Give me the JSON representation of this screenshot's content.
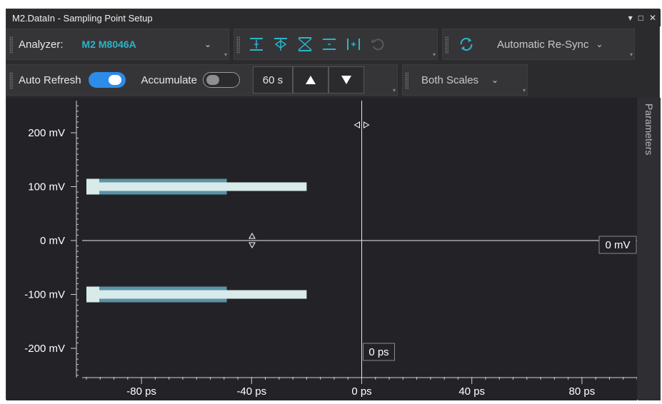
{
  "window": {
    "title": "M2.DataIn - Sampling Point Setup",
    "controls": [
      "▾",
      "□",
      "✕"
    ]
  },
  "toolbar1": {
    "analyzer_label": "Analyzer:",
    "analyzer_value": "M2 M8046A",
    "resync_label": "Automatic Re-Sync",
    "icons": [
      "center-vertical-icon",
      "center-eye-icon",
      "fit-eye-icon",
      "center-horizontal-icon",
      "cursor-offset-icon",
      "undo-icon",
      "resync-icon"
    ]
  },
  "toolbar2": {
    "auto_refresh_label": "Auto Refresh",
    "auto_refresh_on": true,
    "accumulate_label": "Accumulate",
    "accumulate_on": false,
    "interval_value": "60 s",
    "scales_label": "Both Scales"
  },
  "plot": {
    "y_ticks": [
      "200 mV",
      "100 mV",
      "0 mV",
      "-100 mV",
      "-200 mV"
    ],
    "x_ticks": [
      "-80 ps",
      "-40 ps",
      "0 ps",
      "40 ps",
      "80 ps"
    ],
    "voltage_marker": "0 mV",
    "time_marker": "0 ps",
    "side_tab": "Parameters"
  },
  "colors": {
    "background": "#232327",
    "bar_light": "#d8eaea",
    "bar_dark": "#5a93a6",
    "accent": "#2bb5c9",
    "toggle_on": "#2d8ce8"
  },
  "chart_data": {
    "type": "bar",
    "orientation": "horizontal",
    "x_unit": "ps",
    "y_unit": "mV",
    "xlim": [
      -100,
      100
    ],
    "ylim": [
      -230,
      230
    ],
    "x_ticks": [
      -80,
      -40,
      0,
      40,
      80
    ],
    "y_ticks": [
      200,
      100,
      0,
      -100,
      -200
    ],
    "bars": [
      {
        "level": 100,
        "inner_from": -100,
        "inner_to": -49,
        "outer_from": -100,
        "outer_to": -20
      },
      {
        "level": -100,
        "inner_from": -100,
        "inner_to": -49,
        "outer_from": -100,
        "outer_to": -20
      }
    ],
    "sampling_point": {
      "time": 0,
      "voltage": 0
    }
  }
}
